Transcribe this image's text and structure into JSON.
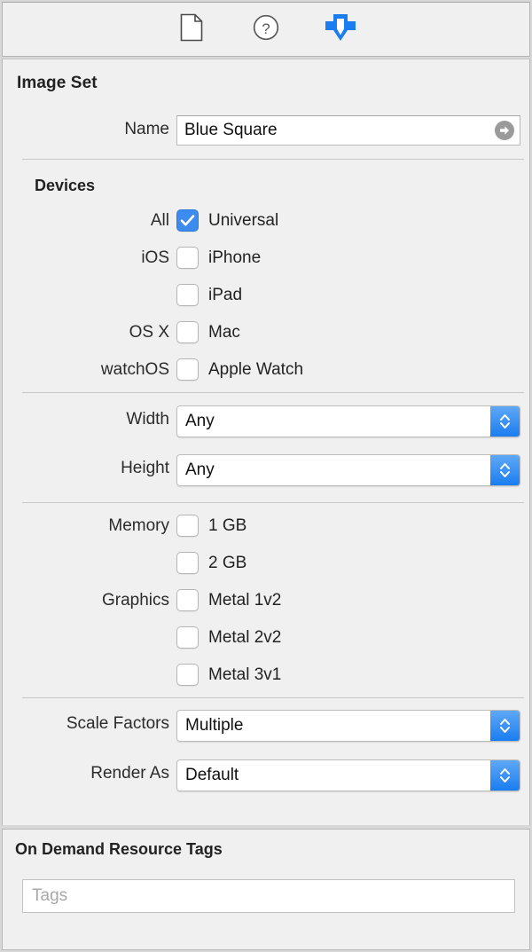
{
  "toolbar": {
    "buttons": [
      {
        "name": "file-inspector",
        "icon": "document-icon",
        "label": "File Inspector"
      },
      {
        "name": "quick-help-inspector",
        "icon": "question-circle-icon",
        "label": "Quick Help Inspector"
      },
      {
        "name": "attributes-inspector",
        "icon": "down-arrow-tag-icon",
        "label": "Attributes Inspector",
        "selected": true
      }
    ]
  },
  "panel": {
    "title": "Image Set",
    "name_row": {
      "label": "Name",
      "value": "Blue Square",
      "go_icon": "arrow-right-circle-icon"
    },
    "devices": {
      "heading": "Devices",
      "rows": [
        {
          "label": "All",
          "text": "Universal",
          "checked": true
        },
        {
          "label": "iOS",
          "text": "iPhone",
          "checked": false
        },
        {
          "label": "",
          "text": "iPad",
          "checked": false
        },
        {
          "label": "OS X",
          "text": "Mac",
          "checked": false
        },
        {
          "label": "watchOS",
          "text": "Apple Watch",
          "checked": false
        }
      ]
    },
    "size_classes": [
      {
        "label": "Width",
        "value": "Any"
      },
      {
        "label": "Height",
        "value": "Any"
      }
    ],
    "capabilities": [
      {
        "label": "Memory",
        "text": "1 GB",
        "checked": false
      },
      {
        "label": "",
        "text": "2 GB",
        "checked": false
      },
      {
        "label": "Graphics",
        "text": "Metal 1v2",
        "checked": false
      },
      {
        "label": "",
        "text": "Metal 2v2",
        "checked": false
      },
      {
        "label": "",
        "text": "Metal 3v1",
        "checked": false
      }
    ],
    "rendering": [
      {
        "label": "Scale Factors",
        "value": "Multiple"
      },
      {
        "label": "Render As",
        "value": "Default"
      }
    ]
  },
  "on_demand": {
    "heading": "On Demand Resource Tags",
    "tags_placeholder": "Tags",
    "tags_value": ""
  },
  "colors": {
    "accent_blue": "#3c8cf0",
    "stepper_blue": "#1a7df0",
    "panel_bg": "#f0f0f0",
    "field_bg": "#ffffff",
    "separator": "#c9c9c9",
    "text": "#222222",
    "placeholder": "#a8a8a8"
  }
}
